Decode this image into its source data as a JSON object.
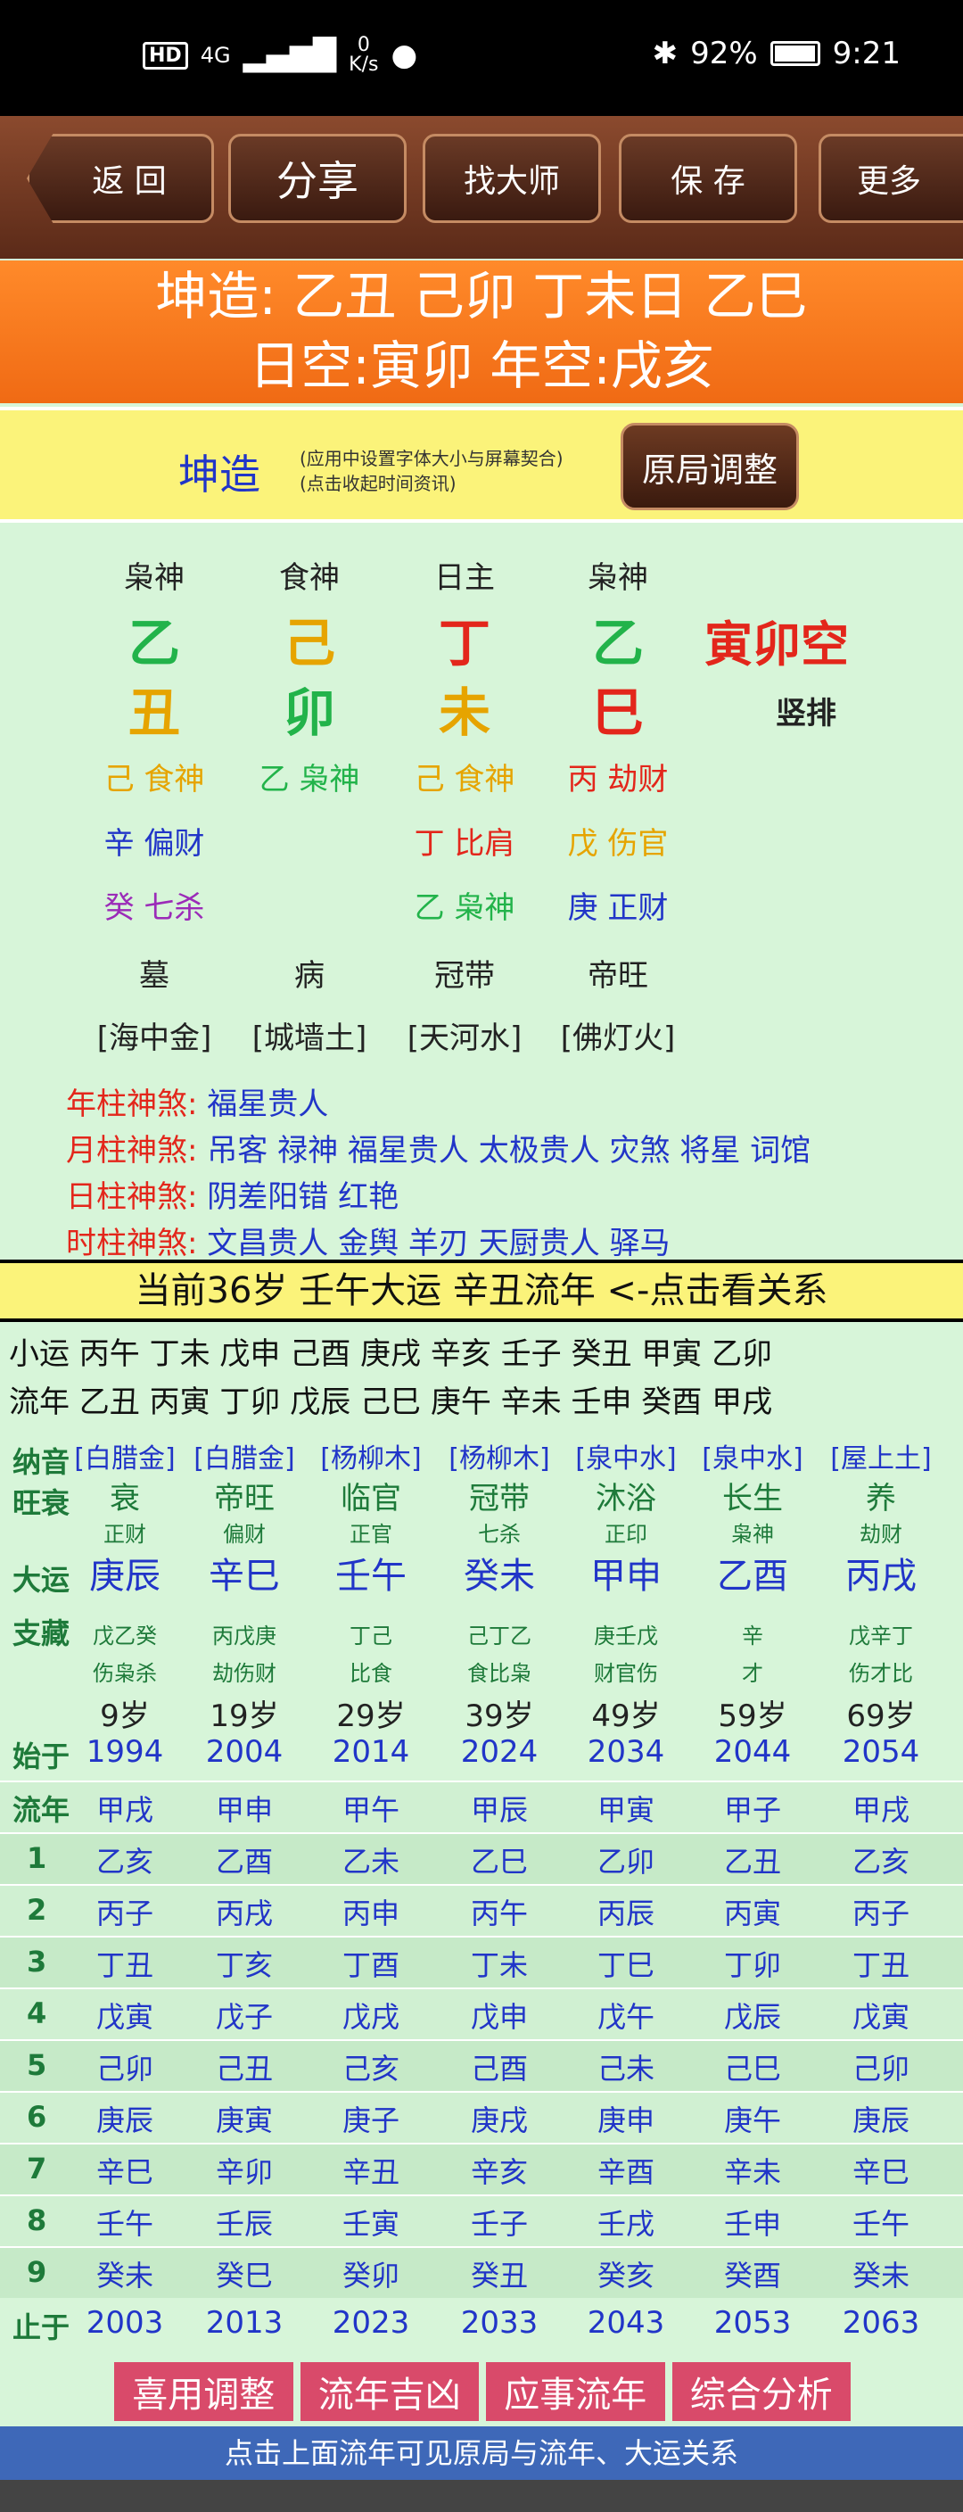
{
  "status": {
    "net_badge": "HD",
    "signal": "4G",
    "speed_top": "0",
    "speed_unit": "K/s",
    "battery": "92%",
    "time": "9:21"
  },
  "toolbar": {
    "back": "返 回",
    "share": "分享",
    "master": "找大师",
    "save": "保 存",
    "more": "更多"
  },
  "header": {
    "line1": "坤造: 乙丑 己卯 丁未日 乙巳",
    "line2": "日空:寅卯 年空:戌亥"
  },
  "bar": {
    "title": "坤造",
    "note1": "(应用中设置字体大小与屏幕契合)",
    "note2": "(点击收起时间资讯)",
    "adjust": "原局调整"
  },
  "pillars": [
    {
      "shen": "枭神",
      "gan": "乙",
      "gan_color": "#22b34a",
      "zhi": "丑",
      "zhi_color": "#e6a400",
      "h1": "己 食神",
      "h1c": "#e6a400",
      "h2": "辛 偏财",
      "h2c": "#2135c8",
      "h3": "癸 七杀",
      "h3c": "#9b2bb8",
      "state": "墓",
      "nayin": "[海中金]"
    },
    {
      "shen": "食神",
      "gan": "己",
      "gan_color": "#e6a400",
      "zhi": "卯",
      "zhi_color": "#22b34a",
      "h1": "乙 枭神",
      "h1c": "#22b34a",
      "h2": "",
      "h2c": "#2135c8",
      "h3": "",
      "h3c": "#2135c8",
      "state": "病",
      "nayin": "[城墙土]"
    },
    {
      "shen": "日主",
      "gan": "丁",
      "gan_color": "#e3261b",
      "zhi": "未",
      "zhi_color": "#e6a400",
      "h1": "己 食神",
      "h1c": "#e6a400",
      "h2": "丁 比肩",
      "h2c": "#e3261b",
      "h3": "乙 枭神",
      "h3c": "#22b34a",
      "state": "冠带",
      "nayin": "[天河水]"
    },
    {
      "shen": "枭神",
      "gan": "乙",
      "gan_color": "#22b34a",
      "zhi": "巳",
      "zhi_color": "#e3261b",
      "h1": "丙 劫财",
      "h1c": "#e3261b",
      "h2": "戊 伤官",
      "h2c": "#e6a400",
      "h3": "庚 正财",
      "h3c": "#2135c8",
      "state": "帝旺",
      "nayin": "[佛灯火]"
    }
  ],
  "empty_label": "寅卯空",
  "vertical_label": "竖排",
  "shensha": [
    {
      "k": "年柱神煞:",
      "v": "福星贵人"
    },
    {
      "k": "月柱神煞:",
      "v": "吊客 禄神 福星贵人 太极贵人 灾煞 将星 词馆"
    },
    {
      "k": "日柱神煞:",
      "v": "阴差阳错 红艳"
    },
    {
      "k": "时柱神煞:",
      "v": "文昌贵人 金舆 羊刃 天厨贵人 驿马"
    }
  ],
  "banner": "当前36岁 壬午大运 辛丑流年  <-点击看关系",
  "xiaoyun": "小运  丙午 丁未 戊申 己酉 庚戌 辛亥 壬子 癸丑 甲寅 乙卯",
  "liunian_line": "流年  乙丑 丙寅 丁卯 戊辰 己巳 庚午 辛未 壬申 癸酉 甲戌",
  "table": {
    "labels": {
      "nayin": "纳音",
      "wang": "旺衰",
      "dayun": "大运",
      "zhicang": "支藏",
      "start": "始于",
      "liunian": "流年",
      "end": "止于"
    },
    "nayin": [
      "[白腊金]",
      "[白腊金]",
      "[杨柳木]",
      "[杨柳木]",
      "[泉中水]",
      "[泉中水]",
      "[屋上土]"
    ],
    "wang": [
      "衰",
      "帝旺",
      "临官",
      "冠带",
      "沐浴",
      "长生",
      "养"
    ],
    "shishen": [
      "正财",
      "偏财",
      "正官",
      "七杀",
      "正印",
      "枭神",
      "劫财"
    ],
    "dayun": [
      "庚辰",
      "辛巳",
      "壬午",
      "癸未",
      "甲申",
      "乙酉",
      "丙戌"
    ],
    "cang1": [
      "戊乙癸",
      "丙戊庚",
      "丁己",
      "己丁乙",
      "庚壬戊",
      "辛",
      "戊辛丁"
    ],
    "cang2": [
      "伤枭杀",
      "劫伤财",
      "比食",
      "食比枭",
      "财官伤",
      "才",
      "伤才比"
    ],
    "age": [
      "9岁",
      "19岁",
      "29岁",
      "39岁",
      "49岁",
      "59岁",
      "69岁"
    ],
    "start": [
      "1994",
      "2004",
      "2014",
      "2024",
      "2034",
      "2044",
      "2054"
    ],
    "years": [
      [
        "甲戌",
        "甲申",
        "甲午",
        "甲辰",
        "甲寅",
        "甲子",
        "甲戌"
      ],
      [
        "乙亥",
        "乙酉",
        "乙未",
        "乙巳",
        "乙卯",
        "乙丑",
        "乙亥"
      ],
      [
        "丙子",
        "丙戌",
        "丙申",
        "丙午",
        "丙辰",
        "丙寅",
        "丙子"
      ],
      [
        "丁丑",
        "丁亥",
        "丁酉",
        "丁未",
        "丁巳",
        "丁卯",
        "丁丑"
      ],
      [
        "戊寅",
        "戊子",
        "戊戌",
        "戊申",
        "戊午",
        "戊辰",
        "戊寅"
      ],
      [
        "己卯",
        "己丑",
        "己亥",
        "己酉",
        "己未",
        "己巳",
        "己卯"
      ],
      [
        "庚辰",
        "庚寅",
        "庚子",
        "庚戌",
        "庚申",
        "庚午",
        "庚辰"
      ],
      [
        "辛巳",
        "辛卯",
        "辛丑",
        "辛亥",
        "辛酉",
        "辛未",
        "辛巳"
      ],
      [
        "壬午",
        "壬辰",
        "壬寅",
        "壬子",
        "壬戌",
        "壬申",
        "壬午"
      ],
      [
        "癸未",
        "癸巳",
        "癸卯",
        "癸丑",
        "癸亥",
        "癸酉",
        "癸未"
      ]
    ],
    "row_nums": [
      "",
      "1",
      "2",
      "3",
      "4",
      "5",
      "6",
      "7",
      "8",
      "9"
    ],
    "end": [
      "2003",
      "2013",
      "2023",
      "2033",
      "2043",
      "2053",
      "2063"
    ]
  },
  "bottom_buttons": [
    "喜用调整",
    "流年吉凶",
    "应事流年",
    "综合分析"
  ],
  "footer": "点击上面流年可见原局与流年、大运关系"
}
